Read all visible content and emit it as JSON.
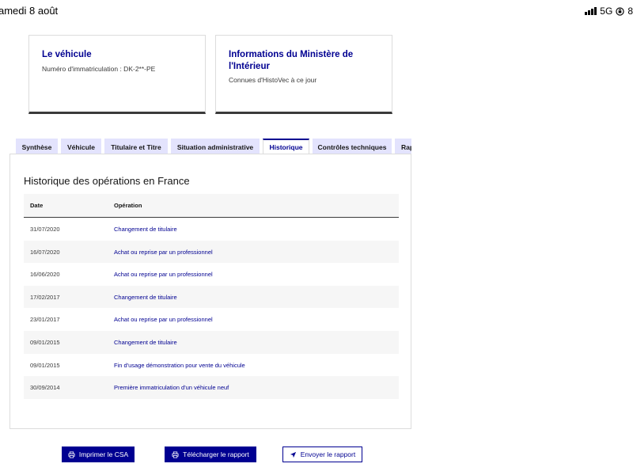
{
  "status_bar": {
    "date": "amedi 8 août",
    "network": "5G",
    "battery": "8"
  },
  "cards": [
    {
      "title": "Le véhicule",
      "text": "Numéro d'immatriculation : DK-2**-PE"
    },
    {
      "title": "Informations du Ministère de l'Intérieur",
      "text": "Connues d'HistoVec à ce jour"
    }
  ],
  "tabs": [
    {
      "label": "Synthèse"
    },
    {
      "label": "Véhicule"
    },
    {
      "label": "Titulaire et Titre"
    },
    {
      "label": "Situation administrative"
    },
    {
      "label": "Historique",
      "active": true
    },
    {
      "label": "Contrôles techniques"
    },
    {
      "label": "Rap"
    }
  ],
  "history": {
    "title": "Historique des opérations en France",
    "columns": {
      "date": "Date",
      "operation": "Opération"
    },
    "rows": [
      {
        "date": "31/07/2020",
        "operation": "Changement de titulaire"
      },
      {
        "date": "16/07/2020",
        "operation": "Achat ou reprise par un professionnel"
      },
      {
        "date": "16/06/2020",
        "operation": "Achat ou reprise par un professionnel"
      },
      {
        "date": "17/02/2017",
        "operation": "Changement de titulaire"
      },
      {
        "date": "23/01/2017",
        "operation": "Achat ou reprise par un professionnel"
      },
      {
        "date": "09/01/2015",
        "operation": "Changement de titulaire"
      },
      {
        "date": "09/01/2015",
        "operation": "Fin d'usage démonstration pour vente du véhicule"
      },
      {
        "date": "30/09/2014",
        "operation": "Première immatriculation d'un véhicule neuf"
      }
    ]
  },
  "actions": {
    "print_csa": "Imprimer le CSA",
    "download_report": "Télécharger le rapport",
    "send_report": "Envoyer le rapport"
  },
  "colors": {
    "primary": "#000091",
    "tab_bg": "#e3e3fd",
    "stripe": "#f6f6f6"
  }
}
